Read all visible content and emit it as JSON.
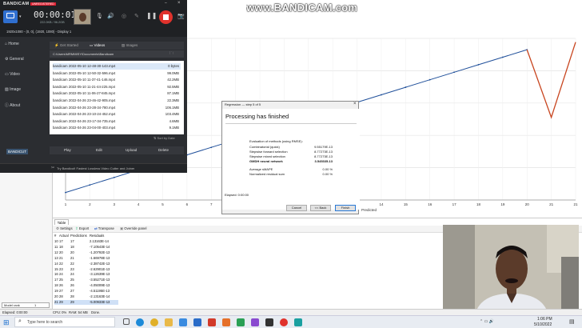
{
  "watermark": "www.BANDICAM.com",
  "bandicam": {
    "logo": "BANDICAM",
    "badge": "UNREGISTERED",
    "timer": "00:00:01",
    "size": "222.0KB / 96.2GB",
    "mode_label": "1920x1080 - (0, 0), (1920, 1080) - Display 1",
    "side": [
      "Home",
      "General",
      "Video",
      "Image",
      "About"
    ],
    "tabs": [
      "Get Started",
      "Videos",
      "Images"
    ],
    "path": "C:\\Users\\MRMMISY\\Documents\\Bandicam",
    "files": [
      {
        "name": "bandicam 2022-05-10 12-48-30-143.mp4",
        "size": "0 bytes"
      },
      {
        "name": "bandicam 2022-05-10 12-50-32-596.mp4",
        "size": "99.0MB"
      },
      {
        "name": "bandicam 2022-05-10 11-37-41-146.mp4",
        "size": "42.2MB"
      },
      {
        "name": "bandicam 2022-05-10 11-21-44-225.mp4",
        "size": "92.5MB"
      },
      {
        "name": "bandicam 2022-05-10 11-06-27-845.mp4",
        "size": "87.1MB"
      },
      {
        "name": "bandicam 2022-04-26 23-46-42-905.mp4",
        "size": "22.3MB"
      },
      {
        "name": "bandicam 2022-04-26 23-28-34-780.mp4",
        "size": "106.1MB"
      },
      {
        "name": "bandicam 2022-04-26 23-10-24-452.mp4",
        "size": "103.4MB"
      },
      {
        "name": "bandicam 2022-04-26 23-17-34-735.mp4",
        "size": "4.6MB"
      },
      {
        "name": "bandicam 2022-04-26 23-04-00-403.mp4",
        "size": "9.1MB"
      }
    ],
    "sort": "Sort by Date",
    "actions": [
      "Play",
      "Edit",
      "Upload",
      "Delete"
    ],
    "bandicut": "BANDICUT",
    "footer": "Try Bandicut! Fastest Lossless Video Cutter and Joiner"
  },
  "dialog": {
    "title": "Regression — step 5 of 5",
    "heading": "Processing has finished",
    "eval_label": "Evaluation of methods (using RMSE):",
    "methods": [
      {
        "name": "Combinatorial (quick)",
        "value": "9.55179E-13"
      },
      {
        "name": "Stepwise forward selection",
        "value": "8.77273E-13"
      },
      {
        "name": "Stepwise mixed selection",
        "value": "8.77273E-13"
      },
      {
        "name": "GMDH neural network",
        "value": "3.545335-13"
      }
    ],
    "metrics": [
      {
        "name": "Average sMAPE",
        "value": "0.00 %"
      },
      {
        "name": "Normalized residual sum",
        "value": "0.00 %"
      }
    ],
    "elapsed": "Elapsed: 0:00:00",
    "buttons": {
      "cancel": "Cancel",
      "back": "<< Back",
      "finish": "Finish"
    }
  },
  "chart": {
    "x_ticks": [
      "1",
      "2",
      "3",
      "4",
      "5",
      "6",
      "7",
      "8",
      "9",
      "10",
      "11",
      "12",
      "13",
      "14",
      "15",
      "16",
      "17",
      "18",
      "19",
      "20",
      "21",
      "21"
    ],
    "legend": "Predicted"
  },
  "chart_data": {
    "type": "line",
    "x": [
      1,
      2,
      3,
      4,
      5,
      6,
      7,
      8,
      9,
      10,
      11,
      12,
      13,
      14,
      15,
      16,
      17,
      18,
      19,
      20,
      21,
      22
    ],
    "series": [
      {
        "values": [
          1,
          2,
          3,
          4,
          5,
          6,
          7,
          8,
          9,
          10,
          11,
          12,
          13,
          14,
          15,
          16,
          17,
          18,
          19,
          20,
          null,
          null
        ]
      },
      {
        "values": [
          null,
          null,
          null,
          null,
          null,
          null,
          null,
          null,
          null,
          null,
          null,
          null,
          null,
          null,
          null,
          null,
          null,
          null,
          null,
          20,
          11,
          21
        ]
      }
    ],
    "xlim": [
      1,
      22
    ],
    "ylim": [
      0,
      21.5
    ],
    "grid": true
  },
  "table": {
    "tab": "Table",
    "toolbar": [
      "Settings",
      "Export",
      "Transpose",
      "Override panel"
    ],
    "headers": [
      "#",
      "Actual",
      "Predictions",
      "Residuals"
    ],
    "rows": [
      [
        "10",
        "17",
        "17",
        "2.13163E-14"
      ],
      [
        "11",
        "18",
        "18",
        "-7.10543E-14"
      ],
      [
        "12",
        "20",
        "20",
        "-1.20792E-13"
      ],
      [
        "13",
        "21",
        "21",
        "-1.66978E-13"
      ],
      [
        "14",
        "22",
        "22",
        "-2.38742E-13"
      ],
      [
        "15",
        "23",
        "23",
        "-2.62901E-13"
      ],
      [
        "16",
        "24",
        "24",
        "-3.12639E-13"
      ],
      [
        "17",
        "25",
        "25",
        "-3.55271E-13"
      ],
      [
        "18",
        "26",
        "26",
        "-4.05009E-13"
      ],
      [
        "19",
        "27",
        "27",
        "-4.51195E-13"
      ],
      [
        "20",
        "28",
        "28",
        "-2.13163E-14"
      ],
      [
        "21",
        "29",
        "29",
        "-5.00933E-13"
      ]
    ]
  },
  "left_strip": {
    "label": "Model rank",
    "value": "1"
  },
  "status": {
    "elapsed": "Elapsed: 0:00:00",
    "cpu": "CPU: 0%",
    "ram": "RAM: 54 MB",
    "state": "Done."
  },
  "taskbar": {
    "search": "Type here to search",
    "time": "1:06 PM",
    "date": "5/10/2022"
  }
}
